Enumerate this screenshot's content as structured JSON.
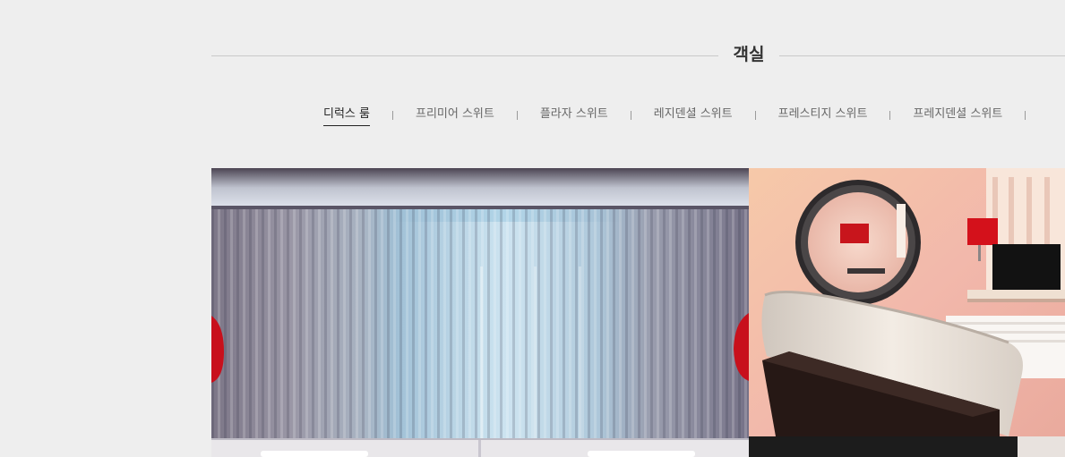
{
  "section": {
    "title": "객실"
  },
  "tabs": [
    {
      "label": "디럭스 룸",
      "active": true
    },
    {
      "label": "프리미어 스위트",
      "active": false
    },
    {
      "label": "플라자 스위트",
      "active": false
    },
    {
      "label": "레지덴셜 스위트",
      "active": false
    },
    {
      "label": "프레스티지 스위트",
      "active": false
    },
    {
      "label": "프레지덴셜 스위트",
      "active": false
    }
  ],
  "colors": {
    "page_background": "#eeeeee",
    "active_tab": "#222222",
    "inactive_tab": "#666666",
    "rule": "#c9c9c9"
  }
}
